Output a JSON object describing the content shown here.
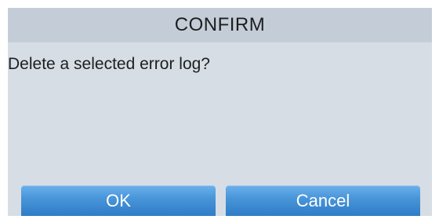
{
  "dialog": {
    "title": "CONFIRM",
    "message": "Delete a selected error log?",
    "ok_label": "OK",
    "cancel_label": "Cancel"
  },
  "colors": {
    "header_bg": "#c4cdd7",
    "body_bg": "#d6dde5",
    "button_top": "#6db1ec",
    "button_bottom": "#2f7cc6",
    "button_text": "#ffffff",
    "text": "#1e1e1e"
  }
}
